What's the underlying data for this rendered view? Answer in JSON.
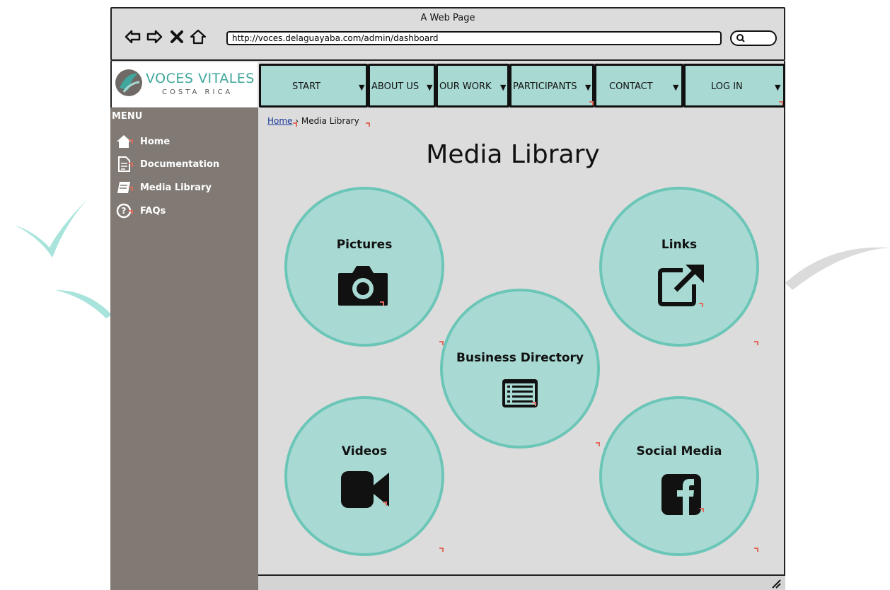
{
  "browser": {
    "title": "A Web Page",
    "url": "http://voces.delaguayaba.com/admin/dashboard"
  },
  "logo": {
    "brand": "VOCES VITALES",
    "sub": "COSTA RICA"
  },
  "nav": {
    "items": [
      {
        "label": "START"
      },
      {
        "label": "ABOUT US"
      },
      {
        "label": "OUR WORK"
      },
      {
        "label": "PARTICIPANTS"
      },
      {
        "label": "CONTACT"
      },
      {
        "label": "LOG IN"
      }
    ]
  },
  "sidebar": {
    "heading": "MENU",
    "items": [
      {
        "label": "Home",
        "icon": "home-icon"
      },
      {
        "label": "Documentation",
        "icon": "document-icon"
      },
      {
        "label": "Media Library",
        "icon": "book-icon"
      },
      {
        "label": "FAQs",
        "icon": "question-icon"
      }
    ]
  },
  "breadcrumb": {
    "home": "Home",
    "current": "Media Library"
  },
  "page": {
    "title": "Media Library"
  },
  "tiles": {
    "pictures": {
      "label": "Pictures",
      "icon": "camera-icon"
    },
    "links": {
      "label": "Links",
      "icon": "external-link-icon"
    },
    "business": {
      "label": "Business Directory",
      "icon": "list-icon"
    },
    "videos": {
      "label": "Videos",
      "icon": "video-camera-icon"
    },
    "social": {
      "label": "Social Media",
      "icon": "facebook-icon"
    }
  },
  "colors": {
    "tile": "#a8dad3",
    "tile_border": "#6cc6b8",
    "sidebar": "#817a74",
    "content_bg": "#dcdcdc",
    "brand": "#3fa79c",
    "link_marker": "#e06a5e"
  }
}
